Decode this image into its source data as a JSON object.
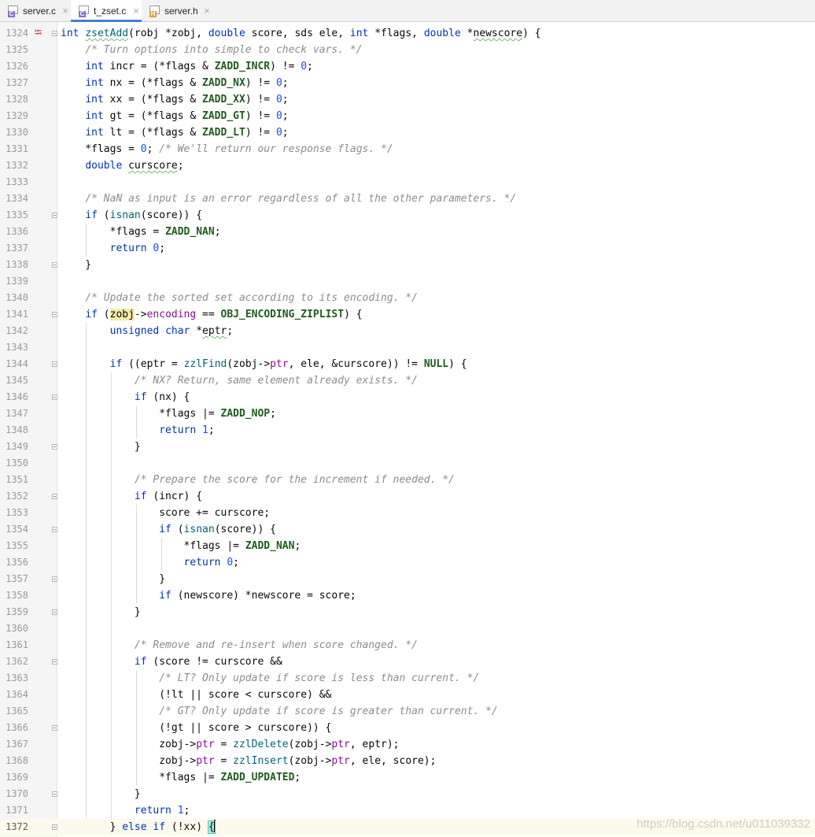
{
  "tabs": [
    {
      "label": "server.c",
      "type": "c",
      "active": false
    },
    {
      "label": "t_zset.c",
      "type": "c",
      "active": true
    },
    {
      "label": "server.h",
      "type": "h",
      "active": false
    }
  ],
  "tab_close_glyph": "×",
  "line_numbers": [
    "1324",
    "1325",
    "1326",
    "1327",
    "1328",
    "1329",
    "1330",
    "1331",
    "1332",
    "1333",
    "1334",
    "1335",
    "1336",
    "1337",
    "1338",
    "1339",
    "1340",
    "1341",
    "1342",
    "1343",
    "1344",
    "1345",
    "1346",
    "1347",
    "1348",
    "1349",
    "1350",
    "1351",
    "1352",
    "1353",
    "1354",
    "1355",
    "1356",
    "1357",
    "1358",
    "1359",
    "1360",
    "1361",
    "1362",
    "1363",
    "1364",
    "1365",
    "1366",
    "1367",
    "1368",
    "1369",
    "1370",
    "1371",
    "1372"
  ],
  "gutter_icons": [
    "override-arrow-icon"
  ],
  "code_lines": [
    "int zsetAdd(robj *zobj, double score, sds ele, int *flags, double *newscore) {",
    "    /* Turn options into simple to check vars. */",
    "    int incr = (*flags & ZADD_INCR) != 0;",
    "    int nx = (*flags & ZADD_NX) != 0;",
    "    int xx = (*flags & ZADD_XX) != 0;",
    "    int gt = (*flags & ZADD_GT) != 0;",
    "    int lt = (*flags & ZADD_LT) != 0;",
    "    *flags = 0; /* We'll return our response flags. */",
    "    double curscore;",
    "",
    "    /* NaN as input is an error regardless of all the other parameters. */",
    "    if (isnan(score)) {",
    "        *flags = ZADD_NAN;",
    "        return 0;",
    "    }",
    "",
    "    /* Update the sorted set according to its encoding. */",
    "    if (zobj->encoding == OBJ_ENCODING_ZIPLIST) {",
    "        unsigned char *eptr;",
    "",
    "        if ((eptr = zzlFind(zobj->ptr, ele, &curscore)) != NULL) {",
    "            /* NX? Return, same element already exists. */",
    "            if (nx) {",
    "                *flags |= ZADD_NOP;",
    "                return 1;",
    "            }",
    "",
    "            /* Prepare the score for the increment if needed. */",
    "            if (incr) {",
    "                score += curscore;",
    "                if (isnan(score)) {",
    "                    *flags |= ZADD_NAN;",
    "                    return 0;",
    "                }",
    "                if (newscore) *newscore = score;",
    "            }",
    "",
    "            /* Remove and re-insert when score changed. */",
    "            if (score != curscore &&",
    "                /* LT? Only update if score is less than current. */",
    "                (!lt || score < curscore) &&",
    "                /* GT? Only update if score is greater than current. */",
    "                (!gt || score > curscore)) {",
    "                zobj->ptr = zzlDelete(zobj->ptr, eptr);",
    "                zobj->ptr = zzlInsert(zobj->ptr, ele, score);",
    "                *flags |= ZADD_UPDATED;",
    "            }",
    "            return 1;",
    "        } else if (!xx) {"
  ],
  "watermark": "https://blog.csdn.net/u011039332"
}
